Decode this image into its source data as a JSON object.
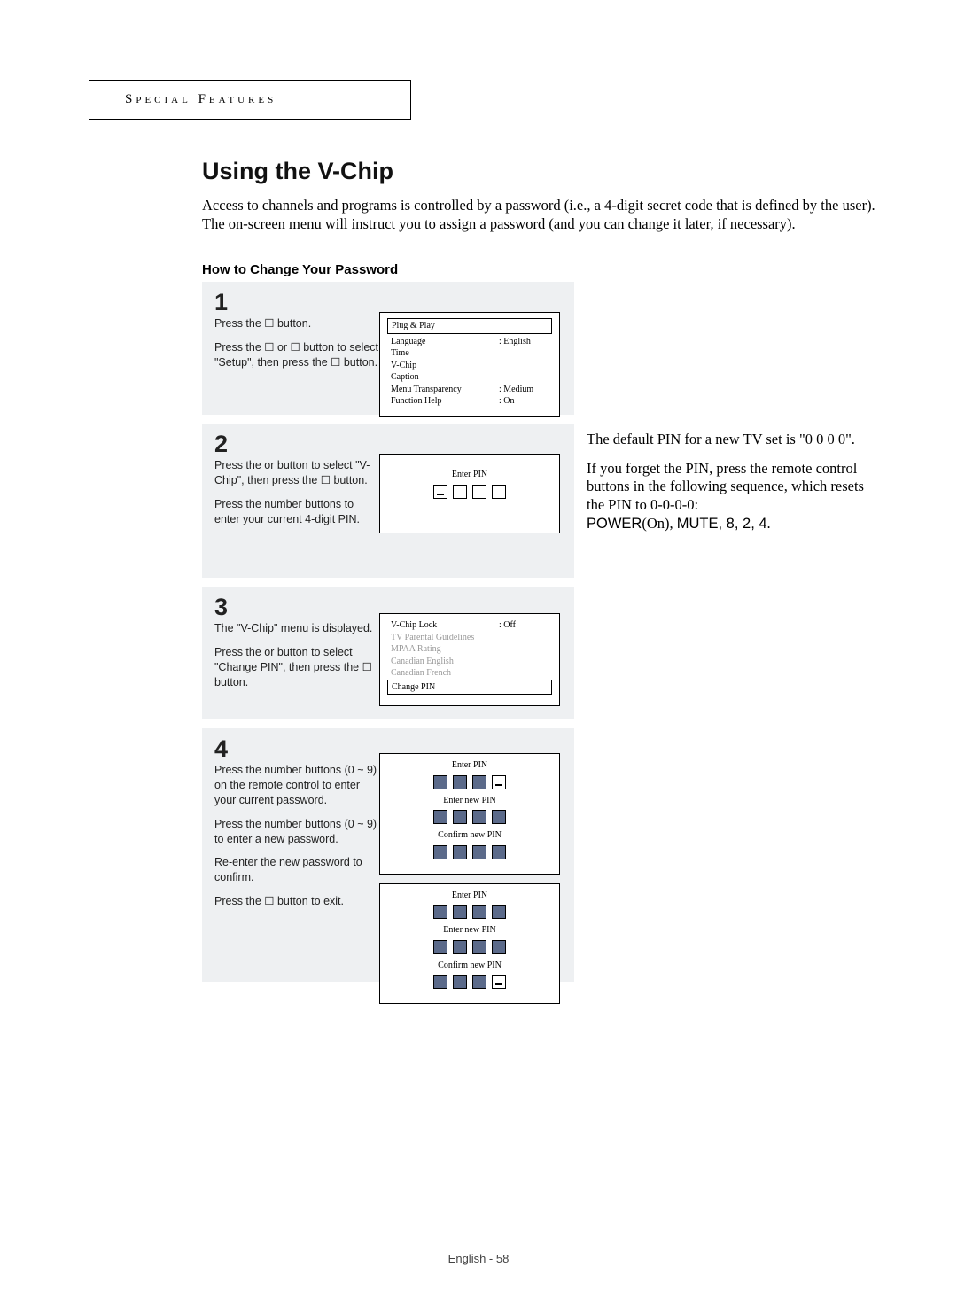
{
  "header": {
    "category": "Special Features"
  },
  "title": "Using the V-Chip",
  "intro": "Access to channels and programs is controlled by a password (i.e., a 4-digit secret code that is defined by the user). The on-screen menu will instruct you to assign a password (and you can change it later, if necessary).",
  "subheading": "How to Change Your Password",
  "steps": [
    {
      "num": "1",
      "lines": [
        "Press the ☐      button.",
        "Press the  ☐  or ☐  button to select \"Setup\", then press the ☐      button."
      ],
      "osd": {
        "type": "setup",
        "selected": "Plug & Play",
        "rows": [
          {
            "label": "Language",
            "value": ":   English"
          },
          {
            "label": "Time",
            "value": ""
          },
          {
            "label": "V-Chip",
            "value": ""
          },
          {
            "label": "Caption",
            "value": ""
          },
          {
            "label": "Menu Transparency",
            "value": ":   Medium"
          },
          {
            "label": "Function Help",
            "value": ":   On"
          }
        ]
      }
    },
    {
      "num": "2",
      "lines": [
        "Press the     or     button to select \"V-Chip\", then press the ☐      button.",
        "Press the number buttons to enter your current 4-digit PIN."
      ],
      "osd": {
        "type": "pin1",
        "label": "Enter PIN",
        "boxes": [
          "cursor",
          "empty",
          "empty",
          "empty"
        ]
      }
    },
    {
      "num": "3",
      "lines": [
        "The \"V-Chip\" menu is displayed.",
        "Press the     or     button to select \"Change PIN\", then press the ☐      button."
      ],
      "osd": {
        "type": "vchip",
        "rows": [
          {
            "label": "V-Chip Lock",
            "value": ":   Off",
            "grey": false
          },
          {
            "label": "TV Parental Guidelines",
            "value": "",
            "grey": true
          },
          {
            "label": "MPAA Rating",
            "value": "",
            "grey": true
          },
          {
            "label": "Canadian English",
            "value": "",
            "grey": true
          },
          {
            "label": "Canadian French",
            "value": "",
            "grey": true
          }
        ],
        "selected": "Change PIN"
      }
    },
    {
      "num": "4",
      "lines": [
        "Press the number buttons (0 ~ 9) on the remote control to enter your current password.",
        "Press the number buttons (0 ~ 9) to enter a new password.",
        "Re-enter the new password to confirm.",
        "Press the ☐     button to exit."
      ],
      "osd": {
        "type": "pin3",
        "panels": [
          {
            "rows": [
              {
                "label": "Enter PIN",
                "boxes": [
                  "filled",
                  "filled",
                  "filled",
                  "cursor"
                ]
              },
              {
                "label": "Enter new PIN",
                "boxes": [
                  "filled",
                  "filled",
                  "filled",
                  "filled"
                ]
              },
              {
                "label": "Confirm new PIN",
                "boxes": [
                  "filled",
                  "filled",
                  "filled",
                  "filled"
                ]
              }
            ]
          },
          {
            "rows": [
              {
                "label": "Enter PIN",
                "boxes": [
                  "filled",
                  "filled",
                  "filled",
                  "filled"
                ]
              },
              {
                "label": "Enter new PIN",
                "boxes": [
                  "filled",
                  "filled",
                  "filled",
                  "filled"
                ]
              },
              {
                "label": "Confirm new PIN",
                "boxes": [
                  "filled",
                  "filled",
                  "filled",
                  "cursor"
                ]
              }
            ]
          }
        ]
      }
    }
  ],
  "sidebar": {
    "p1": "The default PIN for a new TV set is \"0 0 0 0\".",
    "p2_a": "If you forget the PIN, press the remote control buttons in the following sequence, which resets the PIN to 0-0-0-0:",
    "p2_seq_prefix": "POWER",
    "p2_seq_mid": "(On), ",
    "p2_seq_mute": "MUTE",
    "p2_seq_rest": ", 8, 2, 4",
    "p2_seq_end": "."
  },
  "footer": "English - 58"
}
